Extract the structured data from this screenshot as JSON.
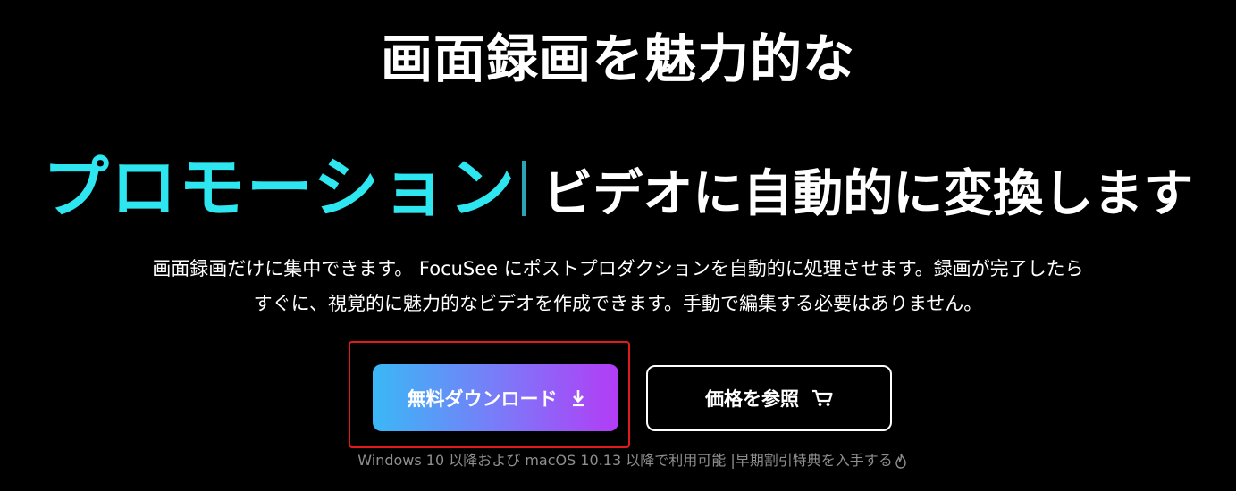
{
  "hero": {
    "title_line1": "画面録画を魅力的な",
    "highlight": "プロモーション",
    "title_rest": "ビデオに自動的に変換します",
    "description_line1": "画面録画だけに集中できます。 FocuSee にポストプロダクションを自動的に処理させます。録画が完了したら",
    "description_line2": "すぐに、視覚的に魅力的なビデオを作成できます。手動で編集する必要はありません。"
  },
  "buttons": {
    "download_label": "無料ダウンロード",
    "download_icon": "download-icon",
    "price_label": "価格を参照",
    "price_icon": "cart-icon"
  },
  "footnote": {
    "text": "Windows 10 以降および macOS 10.13 以降で利用可能 |早期割引特典を入手する",
    "icon": "flame-icon"
  },
  "colors": {
    "background": "#000000",
    "highlight": "#2ee6f0",
    "cursor": "#2aa5b5",
    "gradient_start": "#3ab8f6",
    "gradient_end": "#b33cf6",
    "focus_outline": "#e21a1a",
    "footnote": "#8e8e8e"
  }
}
